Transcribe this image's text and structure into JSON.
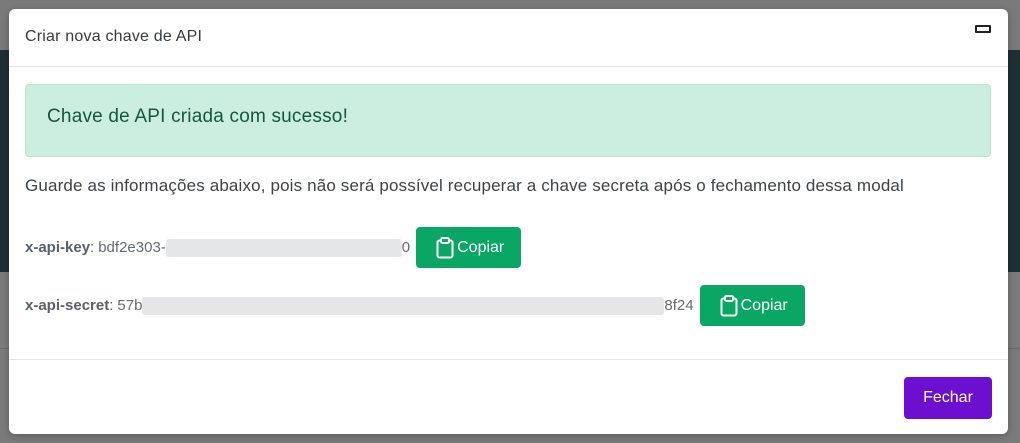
{
  "modal": {
    "title": "Criar nova chave de API",
    "minimize_icon": "minimize-icon",
    "alert": {
      "message": "Chave de API criada com sucesso!",
      "color": "#cceee0"
    },
    "info": "Guarde as informações abaixo, pois não será possível recuperar a chave secreta após o fechamento dessa modal",
    "api_key": {
      "label": "x-api-key",
      "separator": ":",
      "value_start": "bdf2e303-",
      "value_end": "0",
      "copy_label": "Copiar",
      "copy_icon": "clipboard-icon"
    },
    "api_secret": {
      "label": "x-api-secret",
      "separator": ":",
      "value_start": "57b",
      "value_end": "8f24",
      "copy_label": "Copiar",
      "copy_icon": "clipboard-icon"
    },
    "footer": {
      "close_label": "Fechar",
      "close_color": "#6d0fcf"
    }
  },
  "colors": {
    "copy_button": "#0aa764",
    "alert_text": "#14573a"
  }
}
